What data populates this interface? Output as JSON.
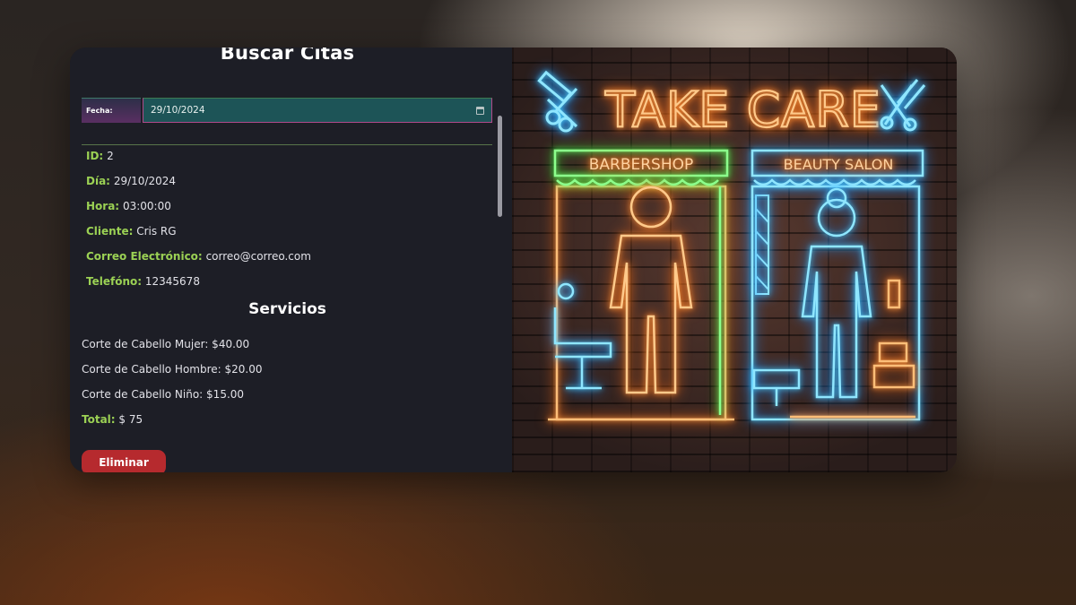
{
  "title": "Buscar Citas",
  "search": {
    "date_label": "Fecha:",
    "date_value": "29/10/2024"
  },
  "appointment": {
    "id_label": "ID:",
    "id_value": "2",
    "day_label": "Día:",
    "day_value": "29/10/2024",
    "hour_label": "Hora:",
    "hour_value": "03:00:00",
    "client_label": "Cliente:",
    "client_value": "Cris RG",
    "email_label": "Correo Electrónico:",
    "email_value": "correo@correo.com",
    "phone_label": "Telefóno:",
    "phone_value": "12345678"
  },
  "services": {
    "title": "Servicios",
    "items": [
      "Corte de Cabello Mujer: $40.00",
      "Corte de Cabello Hombre: $20.00",
      "Corte de Cabello Niño: $15.00"
    ],
    "total_label": "Total:",
    "total_value": "$ 75"
  },
  "actions": {
    "delete_label": "Eliminar"
  },
  "image_sign": {
    "headline": "TAKE CARE",
    "left_banner": "BARBERSHOP",
    "right_banner": "BEAUTY SALON"
  },
  "colors": {
    "label_accent": "#9bd154",
    "delete_button": "#b62a2e",
    "date_input_bg": "#1d5457",
    "panel_bg": "#1d1e26"
  }
}
